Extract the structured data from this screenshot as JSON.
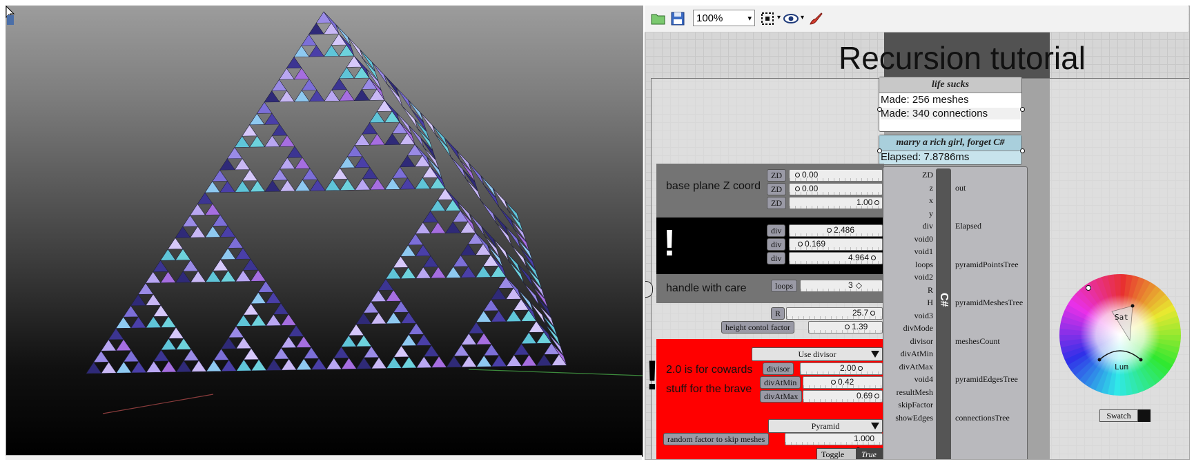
{
  "toolbar": {
    "zoom": "100%",
    "icons": [
      "open-folder-icon",
      "save-disk-icon",
      "zoom-dropdown-arrow",
      "select-region-icon",
      "preview-eye-icon",
      "paint-brush-icon"
    ]
  },
  "canvas": {
    "title": "Recursion tutorial"
  },
  "groups": {
    "base_plane": "base plane Z coord",
    "exclaim": "!",
    "handle": "handle with care",
    "red1": "2.0 is for cowards",
    "red2": "stuff for the brave"
  },
  "panels": {
    "life": {
      "title": "life sucks",
      "lines": [
        "Made: 256 meshes",
        "Made: 340 connections"
      ]
    },
    "marry": {
      "title": "marry a rich girl, forget C#",
      "lines": [
        "Elapsed: 7.8786ms"
      ]
    }
  },
  "sliders": [
    {
      "label": "ZD",
      "value": "0.00"
    },
    {
      "label": "ZD",
      "value": "0.00"
    },
    {
      "label": "ZD",
      "value": "1.00"
    },
    {
      "label": "div",
      "value": "2.486"
    },
    {
      "label": "div",
      "value": "0.169"
    },
    {
      "label": "div",
      "value": "4.964"
    },
    {
      "label": "loops",
      "value": "3"
    },
    {
      "label": "R",
      "value": "25.7"
    },
    {
      "label": "height contol factor",
      "value": "1.39"
    },
    {
      "label": "divisor",
      "value": "2.00"
    },
    {
      "label": "divAtMin",
      "value": "0.42"
    },
    {
      "label": "divAtMax",
      "value": "0.69"
    },
    {
      "label": "random factor to skip meshes",
      "value": "1.000"
    }
  ],
  "dropdowns": {
    "divmode": "Use divisor",
    "shape": "Pyramid"
  },
  "toggle": {
    "label": "Toggle",
    "value": "True"
  },
  "csharp": {
    "glyph": "C#",
    "inputs": [
      "ZD",
      "z",
      "x",
      "y",
      "div",
      "void0",
      "void1",
      "loops",
      "void2",
      "R",
      "H",
      "void3",
      "divMode",
      "divisor",
      "divAtMin",
      "divAtMax",
      "void4",
      "resultMesh",
      "skipFactor",
      "showEdges"
    ],
    "outputs": [
      "out",
      "Elapsed",
      "pyramidPointsTree",
      "pyramidMeshesTree",
      "meshesCount",
      "pyramidEdgesTree",
      "connectionsTree"
    ]
  },
  "colorwheel": {
    "sat": "Sat",
    "lum": "Lum",
    "swatch": "Swatch"
  }
}
